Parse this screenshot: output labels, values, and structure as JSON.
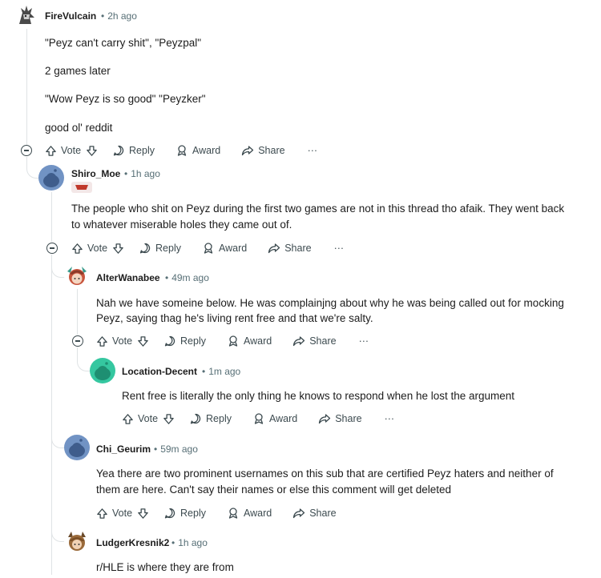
{
  "comments": [
    {
      "username": "FireVulcain",
      "time": "2h ago",
      "paragraphs": [
        "\"Peyz can't carry shit\", \"Peyzpal\"",
        "2 games later",
        "\"Wow Peyz is so good\" \"Peyzker\"",
        "good ol' reddit"
      ]
    },
    {
      "username": "Shiro_Moe",
      "time": "1h ago",
      "paragraphs": [
        "The people who shit on Peyz during the first two games are not in this thread tho afaik. They went back",
        "to whatever miserable holes they came out of."
      ]
    },
    {
      "username": "AlterWanabee",
      "time": "49m ago",
      "paragraphs": [
        "Nah we have someine below. He was complainjng about why he was being called out for mocking",
        "Peyz, saying thag he's living rent free and that we're salty."
      ]
    },
    {
      "username": "Location-Decent",
      "time": "1m ago",
      "paragraphs": [
        "Rent free is literally the only thing he knows to respond when he lost the argument"
      ]
    },
    {
      "username": "Chi_Geurim",
      "time": "59m ago",
      "paragraphs": [
        "Yea there are two prominent usernames on this sub that are certified Peyz haters and neither of",
        "them are here. Can't say their names or else this comment will get deleted"
      ]
    },
    {
      "username": "LudgerKresnik2",
      "time": "1h ago",
      "paragraphs": [
        "r/HLE is where they are from"
      ]
    }
  ],
  "actions": {
    "vote": "Vote",
    "reply": "Reply",
    "award": "Award",
    "share": "Share",
    "more": "···"
  },
  "meta_separator": "•",
  "colors": {
    "text": "#1c1c1c",
    "meta": "#576f76",
    "thread_line": "#dfe3e5",
    "snoo_blue": "#7193c4",
    "snoo_green": "#35c7a0"
  }
}
